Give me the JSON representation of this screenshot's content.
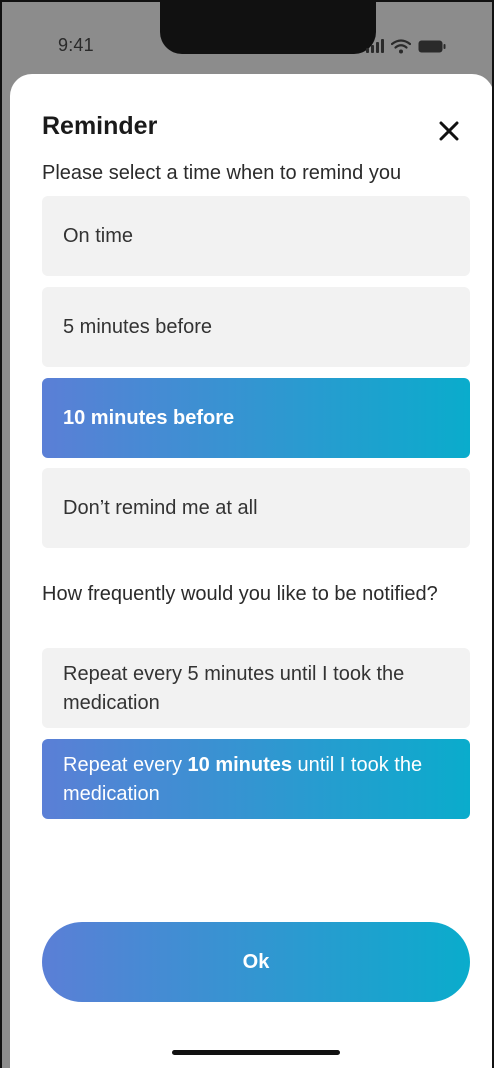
{
  "status_bar": {
    "time": "9:41",
    "icons": [
      "signal-icon",
      "wifi-icon",
      "battery-icon"
    ]
  },
  "reminder": {
    "title": "Reminder",
    "close_icon": "close-icon",
    "subtitle": "Please select a time when to remind you",
    "options": [
      {
        "label": "On time",
        "selected": false
      },
      {
        "label": "5 minutes before",
        "selected": false
      },
      {
        "label": "10 minutes before",
        "selected": true
      },
      {
        "label": "Don’t remind me at all",
        "selected": false
      }
    ],
    "frequency_question": "How frequently would you like to be notified?",
    "frequency_options": [
      {
        "before": "Repeat every 5 minutes until I took the medication",
        "bold": "",
        "after": "",
        "selected": false
      },
      {
        "before": "Repeat every ",
        "bold": "10 minutes",
        "after": " until I took the medication",
        "selected": true
      }
    ],
    "ok_label": "Ok"
  },
  "colors": {
    "gradient_start": "#5b7fd6",
    "gradient_end": "#0aaccc",
    "option_bg": "#f2f2f2"
  }
}
